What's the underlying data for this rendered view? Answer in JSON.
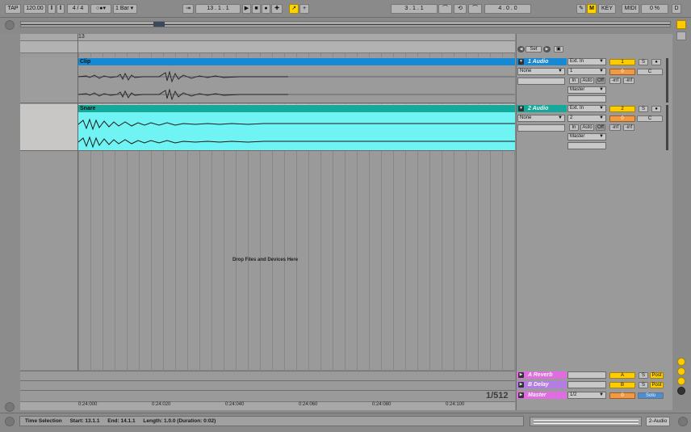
{
  "control_bar": {
    "tap": "TAP",
    "tempo": "120.00",
    "signature": "4 / 4",
    "quantize": "1 Bar",
    "position": "13 .   1 .   1",
    "loop_start": "3 .   1 .   1",
    "loop_length": "4 .   0 .   0",
    "key": "KEY",
    "midi": "MIDI",
    "cpu": "0 %",
    "disk": "D"
  },
  "arrangement": {
    "ruler_bar": "13",
    "drop_text": "Drop Files and Devices Here",
    "zoom_readout": "1/512",
    "time_ticks": [
      "0:24:000",
      "0:24:020",
      "0:24:040",
      "0:24:060",
      "0:24:080",
      "0:24:100"
    ],
    "set_label": "Set",
    "tracks": [
      {
        "clip_name": "Clip",
        "color": "#1689d6",
        "body_color": "#9b9b9b"
      },
      {
        "clip_name": "Snare",
        "color": "#14a99a",
        "body_color": "#70f3f3"
      }
    ]
  },
  "mixer": {
    "tracks": [
      {
        "title": "1 Audio",
        "title_color": "#1689d6",
        "input_type": "Ext. In",
        "input_channel": "1",
        "device": "None",
        "monitor_in": "In",
        "monitor_auto": "Auto",
        "monitor_off": "Off",
        "output": "Master",
        "number": "1",
        "solo": "S",
        "arm": "●",
        "volume": "0",
        "pan": "C",
        "peak_left": "-inf",
        "peak_right": "-inf"
      },
      {
        "title": "2 Audio",
        "title_color": "#14a99a",
        "input_type": "Ext. In",
        "input_channel": "2",
        "device": "None",
        "monitor_in": "In",
        "monitor_auto": "Auto",
        "monitor_off": "Off",
        "output": "Master",
        "number": "2",
        "solo": "S",
        "arm": "●",
        "volume": "0",
        "pan": "C",
        "peak_left": "-inf",
        "peak_right": "-inf"
      }
    ],
    "returns": [
      {
        "title": "A Reverb",
        "letter": "A",
        "solo": "S",
        "post": "Post",
        "color": "#e16be0"
      },
      {
        "title": "B Delay",
        "letter": "B",
        "solo": "S",
        "post": "Post",
        "color": "#b67be6"
      }
    ],
    "master": {
      "title": "Master",
      "cue": "1/2",
      "volume": "0",
      "solo_label": "Solo",
      "color": "#e16be0"
    }
  },
  "status_bar": {
    "label": "Time Selection",
    "start": "Start: 13.1.1",
    "end": "End: 14.1.1",
    "length": "Length: 1.0.0  (Duration: 0:02)",
    "track": "2-Audio"
  },
  "colors": {
    "accent_yellow": "#ffcc00",
    "accent_orange": "#f09a44",
    "track1": "#1689d6",
    "track2": "#14a99a"
  }
}
